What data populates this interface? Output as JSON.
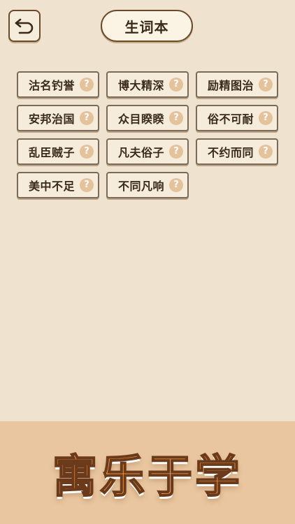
{
  "header": {
    "back_icon": "undo-arrow-icon",
    "title": "生词本"
  },
  "words": [
    {
      "text": "沽名钓誉",
      "help": "?"
    },
    {
      "text": "博大精深",
      "help": "?"
    },
    {
      "text": "励精图治",
      "help": "?"
    },
    {
      "text": "安邦治国",
      "help": "?"
    },
    {
      "text": "众目睽睽",
      "help": "?"
    },
    {
      "text": "俗不可耐",
      "help": "?"
    },
    {
      "text": "乱臣贼子",
      "help": "?"
    },
    {
      "text": "凡夫俗子",
      "help": "?"
    },
    {
      "text": "不约而同",
      "help": "?"
    },
    {
      "text": "美中不足",
      "help": "?"
    },
    {
      "text": "不同凡响",
      "help": "?"
    }
  ],
  "banner": {
    "text": "寓乐于学"
  },
  "colors": {
    "background": "#efe3cf",
    "banner": "#e9c69f",
    "border": "#6b4a2a",
    "help_icon": "#e4c39c",
    "banner_text": "#f2a04b"
  }
}
